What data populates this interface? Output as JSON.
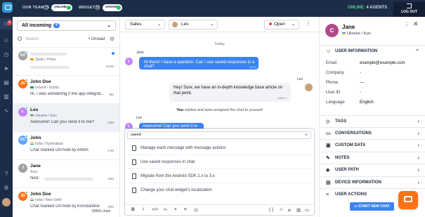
{
  "topbar": {
    "our_team_label": "OUR TEAM IS",
    "team_status": "ONLINE",
    "widget_label": "WIDGET IS",
    "widget_status": "SHOWN",
    "online_label": "ONLINE:",
    "agents": "4 AGENTS",
    "logout": "LOG OUT"
  },
  "leftbar": {
    "badge": "4"
  },
  "chatlist": {
    "filter_label": "All incoming",
    "filter_count": "4",
    "search_placeholder": "Search",
    "unread_label": "Unread",
    "items": [
      {
        "initials": "DZ",
        "name": "",
        "location": "Spain / Poiso",
        "message": "",
        "time": "NOW",
        "color": "#a3a3a3"
      },
      {
        "initials": "JD",
        "name": "John Doe",
        "location": "Ireland / Dublin",
        "message": "Hi, I was wondering if the app integrat...",
        "time": "8M",
        "color": "#f97316"
      },
      {
        "initials": "L",
        "name": "Les",
        "location": "Ukraine / Kyiv",
        "message": "Awesome! Can you send it to me?",
        "time": "13M",
        "color": "#c084fc"
      },
      {
        "initials": "DC",
        "name": "John",
        "location": "India / Hyderabad",
        "message": "Chat marked On-hold by Artem",
        "time": "17M",
        "color": "#60a5fa"
      },
      {
        "initials": "J",
        "name": "Jane",
        "location": "Asia",
        "message": "Nick:",
        "time": "24M",
        "color": "#a3a3a3"
      },
      {
        "initials": "JD",
        "name": "John Doe",
        "location": "India / New Delhi",
        "message": "Chat marked On-hold by Konstantine",
        "time": "29M",
        "color": "#f97316"
      }
    ],
    "footer": "19000 chats"
  },
  "main": {
    "department": "Sales",
    "agent": "Les",
    "status": "Open",
    "date_divider": "Today",
    "messages": {
      "m1_sender": "Jane",
      "m1_text": "Hi there! I have a question. Can I use saved responses in a chat?",
      "m1_time": "18:24",
      "m2_sender": "Les",
      "m2_text": "Hey! Sure, we have an in-depth knowledge base article on that point.",
      "m2_time": "18:24",
      "system_actor": "You",
      "system_text": " replied and auto-assigned the chat to yourself",
      "m3_sender": "Les",
      "m3_text": "Awesome! Can you send it to me?"
    },
    "composer": {
      "search_value": "saved",
      "suggestions": [
        "Manage each message with message actions",
        "Use saved responses in chat",
        "Migrate from the Android SDK 2.x to 3.x",
        "Change your chat widget's localization"
      ],
      "format_icons": [
        "B",
        "I",
        "<>",
        "link",
        "quote",
        "list",
        "clock",
        "{}",
        "emoji",
        "attach",
        "book",
        "chat"
      ]
    }
  },
  "rpanel": {
    "initials": "C",
    "name": "Jane",
    "location": "Ukraine / Kyiv",
    "section_user_info": "USER INFORMATION",
    "fields": [
      {
        "key": "Email",
        "value": "example@example.com"
      },
      {
        "key": "Company",
        "value": "-"
      },
      {
        "key": "Phone",
        "value": "—"
      },
      {
        "key": "User ID",
        "value": "-"
      },
      {
        "key": "Language",
        "value": "English"
      }
    ],
    "sections": [
      "TAGS",
      "CONVERSATIONS",
      "CUSTOM DATA",
      "NOTES",
      "USER PATH",
      "DEVICE INFORMATION",
      "USER ACTIONS"
    ],
    "start_chat": "START NEW CHAT"
  }
}
